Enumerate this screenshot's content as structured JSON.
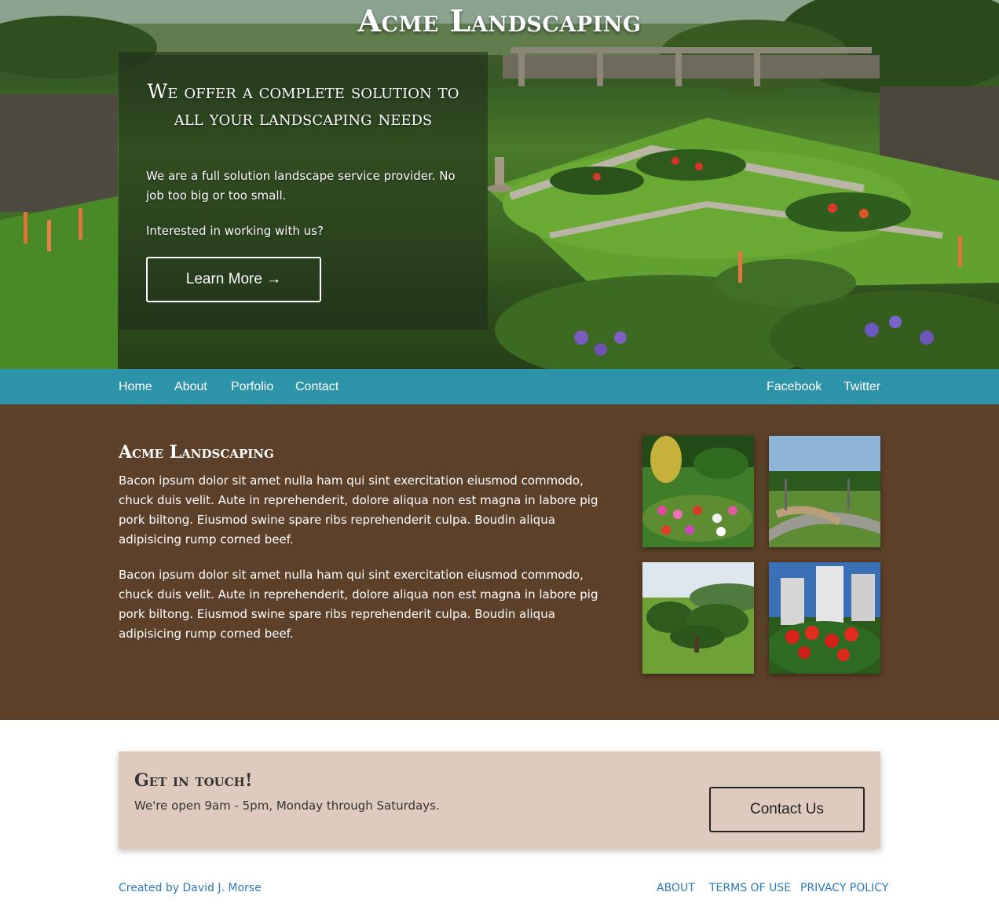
{
  "hero": {
    "site_title": "Acme Landscaping",
    "heading": "We offer a complete solution to all your landscaping needs",
    "text_1": "We are a full solution landscape service provider. No job too big or too small.",
    "text_2": "Interested in working with us?",
    "button_label": "Learn More →"
  },
  "nav": {
    "left": [
      "Home",
      "About",
      "Porfolio",
      "Contact"
    ],
    "right": [
      "Facebook",
      "Twitter"
    ]
  },
  "about": {
    "title": "Acme Landscaping",
    "paragraph_1": "Bacon ipsum dolor sit amet nulla ham qui sint exercitation eiusmod commodo, chuck duis velit. Aute in reprehenderit, dolore aliqua non est magna in labore pig pork biltong. Eiusmod swine spare ribs reprehenderit culpa. Boudin aliqua adipisicing rump corned beef.",
    "paragraph_2": "Bacon ipsum dolor sit amet nulla ham qui sint exercitation eiusmod commodo, chuck duis velit. Aute in reprehenderit, dolore aliqua non est magna in labore pig pork biltong. Eiusmod swine spare ribs reprehenderit culpa. Boudin aliqua adipisicing rump corned beef."
  },
  "contact": {
    "title": "Get in touch!",
    "text": "We're open 9am - 5pm, Monday through Saturdays.",
    "button_label": "Contact Us"
  },
  "footer": {
    "credit": "Created by David J. Morse",
    "links": [
      "ABOUT",
      "TERMS OF USE",
      "PRIVACY POLICY"
    ]
  },
  "colors": {
    "nav_bg": "#2d93a8",
    "about_bg": "#5c4029",
    "contact_bg": "#dfcbbd",
    "footer_link": "#2a7ab8"
  }
}
